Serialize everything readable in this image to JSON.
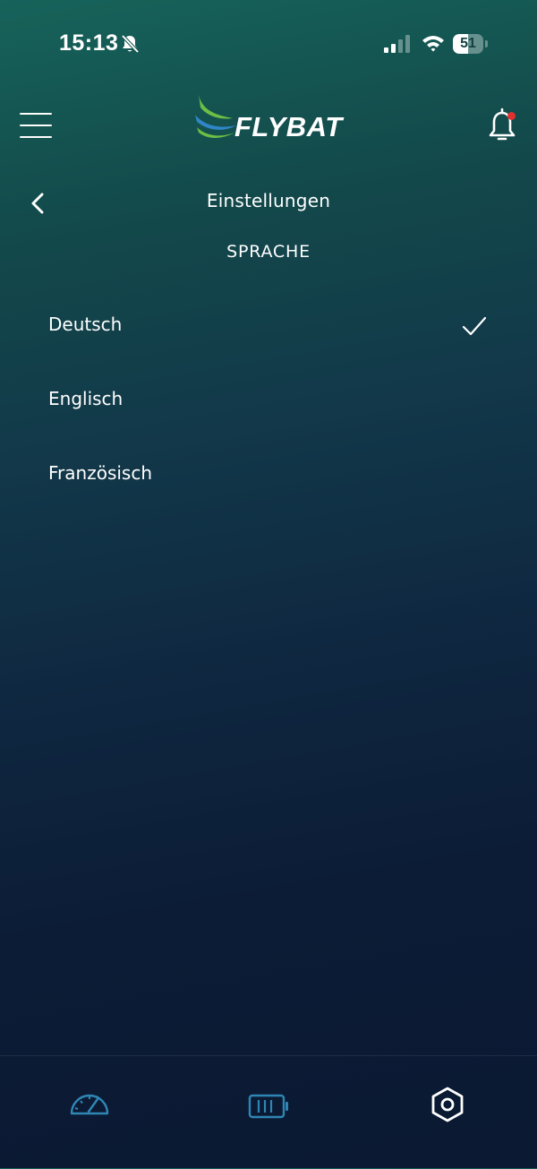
{
  "status_bar": {
    "time": "15:13",
    "battery_level": "51",
    "battery_fraction": 0.51,
    "signal_bars": 2
  },
  "header": {
    "logo_text": "FLYBAT",
    "notification_dot_color": "#e0312f"
  },
  "page": {
    "title": "Einstellungen",
    "section": "SPRACHE"
  },
  "languages": [
    {
      "label": "Deutsch",
      "selected": true
    },
    {
      "label": "Englisch",
      "selected": false
    },
    {
      "label": "Französisch",
      "selected": false
    }
  ],
  "tabbar": {
    "items": [
      {
        "icon": "speedometer-icon",
        "active": false
      },
      {
        "icon": "battery-icon",
        "active": false
      },
      {
        "icon": "hexagon-nut-icon",
        "active": true
      }
    ],
    "inactive_color": "#2f86b5",
    "active_color": "#ffffff"
  },
  "colors": {
    "logo_green": "#6bbf45",
    "logo_blue": "#2f86c5"
  }
}
